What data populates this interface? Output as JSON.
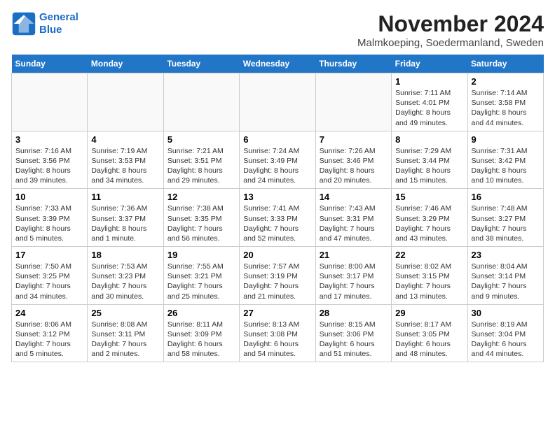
{
  "header": {
    "logo_line1": "General",
    "logo_line2": "Blue",
    "title": "November 2024",
    "subtitle": "Malmkoeping, Soedermanland, Sweden"
  },
  "days_of_week": [
    "Sunday",
    "Monday",
    "Tuesday",
    "Wednesday",
    "Thursday",
    "Friday",
    "Saturday"
  ],
  "weeks": [
    [
      {
        "day": "",
        "text": ""
      },
      {
        "day": "",
        "text": ""
      },
      {
        "day": "",
        "text": ""
      },
      {
        "day": "",
        "text": ""
      },
      {
        "day": "",
        "text": ""
      },
      {
        "day": "1",
        "text": "Sunrise: 7:11 AM\nSunset: 4:01 PM\nDaylight: 8 hours\nand 49 minutes."
      },
      {
        "day": "2",
        "text": "Sunrise: 7:14 AM\nSunset: 3:58 PM\nDaylight: 8 hours\nand 44 minutes."
      }
    ],
    [
      {
        "day": "3",
        "text": "Sunrise: 7:16 AM\nSunset: 3:56 PM\nDaylight: 8 hours\nand 39 minutes."
      },
      {
        "day": "4",
        "text": "Sunrise: 7:19 AM\nSunset: 3:53 PM\nDaylight: 8 hours\nand 34 minutes."
      },
      {
        "day": "5",
        "text": "Sunrise: 7:21 AM\nSunset: 3:51 PM\nDaylight: 8 hours\nand 29 minutes."
      },
      {
        "day": "6",
        "text": "Sunrise: 7:24 AM\nSunset: 3:49 PM\nDaylight: 8 hours\nand 24 minutes."
      },
      {
        "day": "7",
        "text": "Sunrise: 7:26 AM\nSunset: 3:46 PM\nDaylight: 8 hours\nand 20 minutes."
      },
      {
        "day": "8",
        "text": "Sunrise: 7:29 AM\nSunset: 3:44 PM\nDaylight: 8 hours\nand 15 minutes."
      },
      {
        "day": "9",
        "text": "Sunrise: 7:31 AM\nSunset: 3:42 PM\nDaylight: 8 hours\nand 10 minutes."
      }
    ],
    [
      {
        "day": "10",
        "text": "Sunrise: 7:33 AM\nSunset: 3:39 PM\nDaylight: 8 hours\nand 5 minutes."
      },
      {
        "day": "11",
        "text": "Sunrise: 7:36 AM\nSunset: 3:37 PM\nDaylight: 8 hours\nand 1 minute."
      },
      {
        "day": "12",
        "text": "Sunrise: 7:38 AM\nSunset: 3:35 PM\nDaylight: 7 hours\nand 56 minutes."
      },
      {
        "day": "13",
        "text": "Sunrise: 7:41 AM\nSunset: 3:33 PM\nDaylight: 7 hours\nand 52 minutes."
      },
      {
        "day": "14",
        "text": "Sunrise: 7:43 AM\nSunset: 3:31 PM\nDaylight: 7 hours\nand 47 minutes."
      },
      {
        "day": "15",
        "text": "Sunrise: 7:46 AM\nSunset: 3:29 PM\nDaylight: 7 hours\nand 43 minutes."
      },
      {
        "day": "16",
        "text": "Sunrise: 7:48 AM\nSunset: 3:27 PM\nDaylight: 7 hours\nand 38 minutes."
      }
    ],
    [
      {
        "day": "17",
        "text": "Sunrise: 7:50 AM\nSunset: 3:25 PM\nDaylight: 7 hours\nand 34 minutes."
      },
      {
        "day": "18",
        "text": "Sunrise: 7:53 AM\nSunset: 3:23 PM\nDaylight: 7 hours\nand 30 minutes."
      },
      {
        "day": "19",
        "text": "Sunrise: 7:55 AM\nSunset: 3:21 PM\nDaylight: 7 hours\nand 25 minutes."
      },
      {
        "day": "20",
        "text": "Sunrise: 7:57 AM\nSunset: 3:19 PM\nDaylight: 7 hours\nand 21 minutes."
      },
      {
        "day": "21",
        "text": "Sunrise: 8:00 AM\nSunset: 3:17 PM\nDaylight: 7 hours\nand 17 minutes."
      },
      {
        "day": "22",
        "text": "Sunrise: 8:02 AM\nSunset: 3:15 PM\nDaylight: 7 hours\nand 13 minutes."
      },
      {
        "day": "23",
        "text": "Sunrise: 8:04 AM\nSunset: 3:14 PM\nDaylight: 7 hours\nand 9 minutes."
      }
    ],
    [
      {
        "day": "24",
        "text": "Sunrise: 8:06 AM\nSunset: 3:12 PM\nDaylight: 7 hours\nand 5 minutes."
      },
      {
        "day": "25",
        "text": "Sunrise: 8:08 AM\nSunset: 3:11 PM\nDaylight: 7 hours\nand 2 minutes."
      },
      {
        "day": "26",
        "text": "Sunrise: 8:11 AM\nSunset: 3:09 PM\nDaylight: 6 hours\nand 58 minutes."
      },
      {
        "day": "27",
        "text": "Sunrise: 8:13 AM\nSunset: 3:08 PM\nDaylight: 6 hours\nand 54 minutes."
      },
      {
        "day": "28",
        "text": "Sunrise: 8:15 AM\nSunset: 3:06 PM\nDaylight: 6 hours\nand 51 minutes."
      },
      {
        "day": "29",
        "text": "Sunrise: 8:17 AM\nSunset: 3:05 PM\nDaylight: 6 hours\nand 48 minutes."
      },
      {
        "day": "30",
        "text": "Sunrise: 8:19 AM\nSunset: 3:04 PM\nDaylight: 6 hours\nand 44 minutes."
      }
    ]
  ]
}
